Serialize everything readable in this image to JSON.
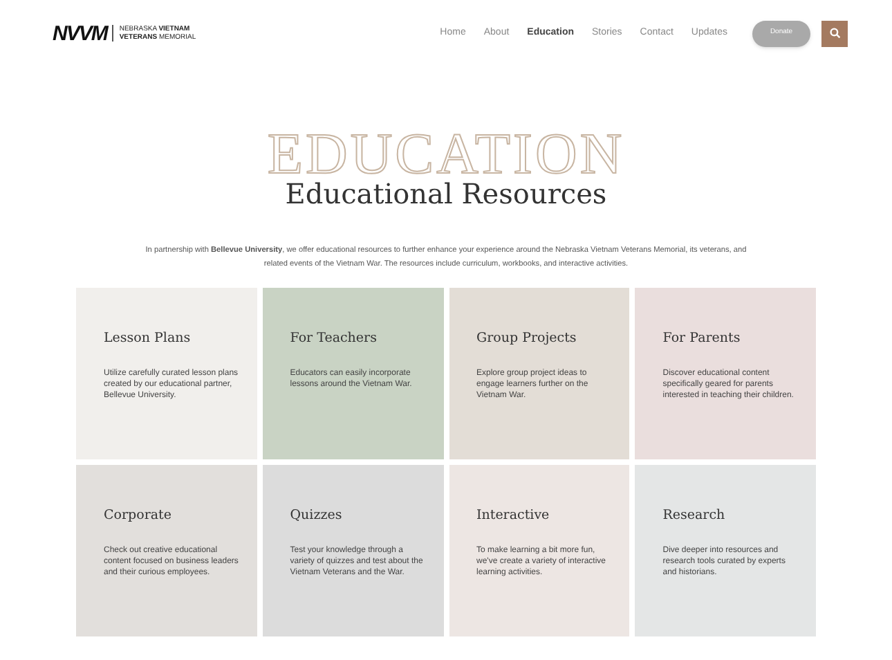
{
  "logo": {
    "mark": "NVVM",
    "line_1_light": "NEBRASKA",
    "line_1_bold": "VIETNAM",
    "line_2_bold": "VETERANS",
    "line_2_light": "MEMORIAL"
  },
  "nav": [
    {
      "label": "Home",
      "selected": false
    },
    {
      "label": "About",
      "selected": false
    },
    {
      "label": "Education",
      "selected": true
    },
    {
      "label": "Stories",
      "selected": false
    },
    {
      "label": "Contact",
      "selected": false
    },
    {
      "label": "Updates",
      "selected": false
    }
  ],
  "donate_button": "Donate",
  "hero": {
    "backdrop": "EDUCATION",
    "title": "Educational Resources",
    "intro": "In partnership with **Bellevue University**, we offer educational resources to further enhance your experience around the Nebraska Vietnam Veterans Memorial, its veterans, and related events of the Vietnam War. The resources include curriculum, workbooks, and interactive activities."
  },
  "cards": [
    {
      "title": "Lesson Plans",
      "text": "Utilize carefully curated lesson plans created by our educational partner, Bellevue University.",
      "color": "#f1efec"
    },
    {
      "title": "For Teachers",
      "text": "Educators can easily incorporate lessons around the Vietnam War.",
      "color": "#c9d3c4"
    },
    {
      "title": "Group Projects",
      "text": "Explore group project ideas to engage learners further on the Vietnam War.",
      "color": "#e3ddd6"
    },
    {
      "title": "For Parents",
      "text": "Discover educational content specifically geared for parents interested in teaching their children.",
      "color": "#eadedd"
    },
    {
      "title": "Corporate",
      "text": "Check out creative educational content focused on business leaders and their curious employees.",
      "color": "#e2dfdc"
    },
    {
      "title": "Quizzes",
      "text": "Test your knowledge through a variety of quizzes and test about the Vietnam Veterans and the War.",
      "color": "#dcdcdc"
    },
    {
      "title": "Interactive",
      "text": "To make learning a bit more fun, we've create a variety of interactive learning activities.",
      "color": "#ede6e3"
    },
    {
      "title": "Research",
      "text": "Dive deeper into resources and research tools curated by experts and historians.",
      "color": "#e4e6e6"
    }
  ]
}
